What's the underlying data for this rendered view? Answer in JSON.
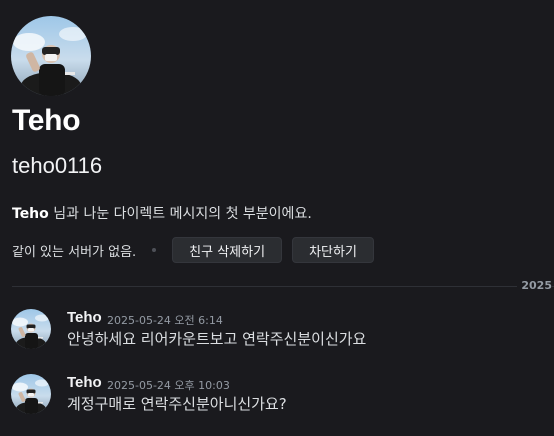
{
  "profile": {
    "display_name": "Teho",
    "username": "teho0116",
    "intro_name": "Teho",
    "intro_rest": " 님과 나눈 다이렉트 메시지의 첫 부분이에요.",
    "no_mutual_servers": "같이 있는 서버가 없음.",
    "remove_friend_label": "친구 삭제하기",
    "block_label": "차단하기",
    "avatar_icon": "user-avatar-photo-icon"
  },
  "date_divider": "2025",
  "messages": [
    {
      "author": "Teho",
      "timestamp": "2025-05-24 오전 6:14",
      "content": "안녕하세요 리어카운트보고 연락주신분이신가요"
    },
    {
      "author": "Teho",
      "timestamp": "2025-05-24 오후 10:03",
      "content": "계정구매로 연락주신분아니신가요?"
    }
  ],
  "colors": {
    "background": "#1a1a1e",
    "button_bg": "#2b2d31",
    "text": "#dbdee1",
    "muted": "#949ba4"
  }
}
